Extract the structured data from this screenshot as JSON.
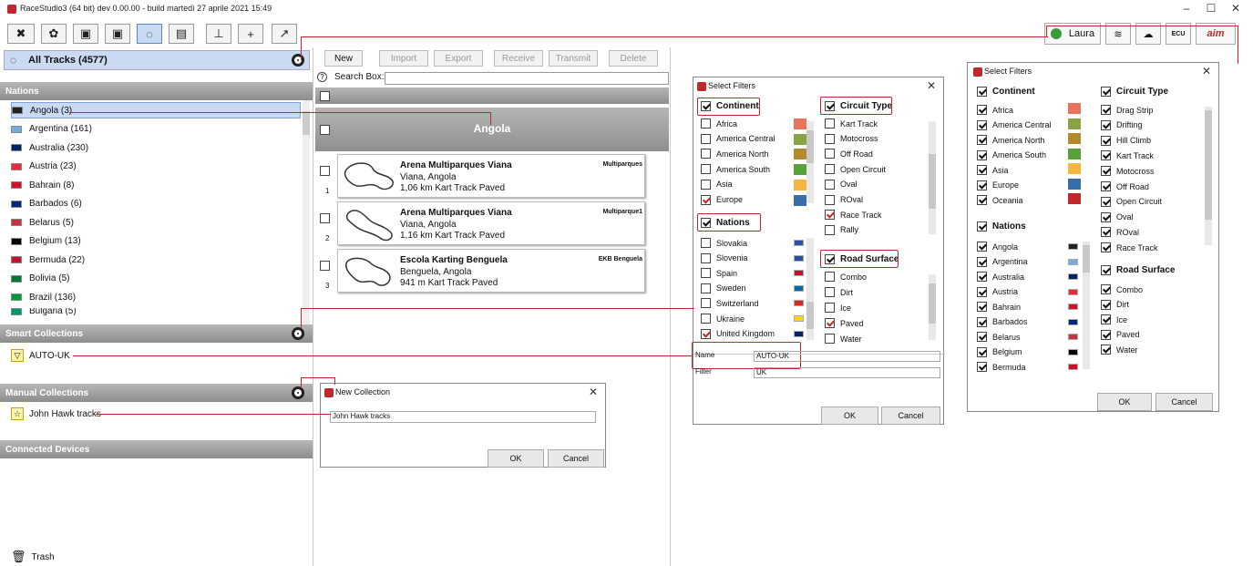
{
  "window": {
    "title": "RaceStudio3 (64 bit) dev 0.00.00 - build martedì 27 aprile 2021 15:49",
    "user": "Laura"
  },
  "toolbar": {
    "icons": [
      "tools-icon",
      "settings-icon",
      "device-icon",
      "device2-icon",
      "tracks-icon",
      "logs-icon",
      "chart-icon",
      "add-icon",
      "export-icon"
    ],
    "right_icons": [
      "wifi-icon",
      "cloud-icon",
      "ecu-icon",
      "aim-logo"
    ],
    "ecu_label": "ECU"
  },
  "left": {
    "all_tracks": "All Tracks (4577)",
    "nations_header": "Nations",
    "nations": [
      {
        "label": "Angola (3)",
        "color": "#222"
      },
      {
        "label": "Argentina (161)",
        "color": "#74acdf"
      },
      {
        "label": "Australia (230)",
        "color": "#012169"
      },
      {
        "label": "Austria (23)",
        "color": "#ed2939"
      },
      {
        "label": "Bahrain (8)",
        "color": "#ce1126"
      },
      {
        "label": "Barbados (6)",
        "color": "#00267f"
      },
      {
        "label": "Belarus (5)",
        "color": "#c8313e"
      },
      {
        "label": "Belgium (13)",
        "color": "#000"
      },
      {
        "label": "Bermuda (22)",
        "color": "#c8102e"
      },
      {
        "label": "Bolivia (5)",
        "color": "#007934"
      },
      {
        "label": "Brazil (136)",
        "color": "#009c3b"
      },
      {
        "label": "Bulgaria (5)",
        "color": "#00966e"
      }
    ],
    "smart_header": "Smart Collections",
    "smart_items": [
      "AUTO-UK"
    ],
    "manual_header": "Manual Collections",
    "manual_items": [
      "John Hawk tracks"
    ],
    "devices_header": "Connected Devices",
    "trash": "Trash"
  },
  "middle": {
    "buttons": {
      "new": "New",
      "import": "Import",
      "export": "Export",
      "receive": "Receive",
      "transmit": "Transmit",
      "delete": "Delete"
    },
    "search_label": "Search Box:",
    "group_title": "Angola",
    "tracks": [
      {
        "num": "1",
        "name": "Arena Multiparques Viana",
        "location": "Viana, Angola",
        "length": "1,06 km Kart Track Paved",
        "tag": "Multiparques"
      },
      {
        "num": "2",
        "name": "Arena Multiparques Viana",
        "location": "Viana, Angola",
        "length": "1,16 km Kart Track Paved",
        "tag": "Multiparque1"
      },
      {
        "num": "3",
        "name": "Escola Karting Benguela",
        "location": "Benguela, Angola",
        "length": "941 m Kart Track Paved",
        "tag": "EKB Benguela"
      }
    ]
  },
  "new_collection": {
    "title": "New Collection",
    "value": "John Hawk tracks",
    "ok": "OK",
    "cancel": "Cancel"
  },
  "filters1": {
    "title": "Select Filters",
    "continent_label": "Continent",
    "continents": [
      {
        "label": "Africa",
        "checked": false
      },
      {
        "label": "America Central",
        "checked": false
      },
      {
        "label": "America North",
        "checked": false
      },
      {
        "label": "America South",
        "checked": false
      },
      {
        "label": "Asia",
        "checked": false
      },
      {
        "label": "Europe",
        "checked": true
      }
    ],
    "nations_label": "Nations",
    "nations": [
      {
        "label": "Slovakia",
        "checked": false
      },
      {
        "label": "Slovenia",
        "checked": false
      },
      {
        "label": "Spain",
        "checked": false
      },
      {
        "label": "Sweden",
        "checked": false
      },
      {
        "label": "Switzerland",
        "checked": false
      },
      {
        "label": "Ukraine",
        "checked": false
      },
      {
        "label": "United Kingdom",
        "checked": true
      }
    ],
    "circuit_label": "Circuit Type",
    "circuits": [
      {
        "label": "Kart Track",
        "checked": false
      },
      {
        "label": "Motocross",
        "checked": false
      },
      {
        "label": "Off Road",
        "checked": false
      },
      {
        "label": "Open Circuit",
        "checked": false
      },
      {
        "label": "Oval",
        "checked": false
      },
      {
        "label": "ROval",
        "checked": false
      },
      {
        "label": "Race Track",
        "checked": true
      },
      {
        "label": "Rally",
        "checked": false
      }
    ],
    "surface_label": "Road Surface",
    "surfaces": [
      {
        "label": "Combo",
        "checked": false
      },
      {
        "label": "Dirt",
        "checked": false
      },
      {
        "label": "Ice",
        "checked": false
      },
      {
        "label": "Paved",
        "checked": true
      },
      {
        "label": "Water",
        "checked": false
      }
    ],
    "name_label": "Name",
    "name_value": "AUTO-UK",
    "filter_label": "Filter",
    "filter_value": "UK",
    "ok": "OK",
    "cancel": "Cancel"
  },
  "filters2": {
    "title": "Select Filters",
    "continent_label": "Continent",
    "continents": [
      "Africa",
      "America Central",
      "America North",
      "America South",
      "Asia",
      "Europe",
      "Oceania"
    ],
    "nations_label": "Nations",
    "nations": [
      "Angola",
      "Argentina",
      "Australia",
      "Austria",
      "Bahrain",
      "Barbados",
      "Belarus",
      "Belgium",
      "Bermuda"
    ],
    "circuit_label": "Circuit Type",
    "circuits": [
      "Drag Strip",
      "Drifting",
      "Hill Climb",
      "Kart Track",
      "Motocross",
      "Off Road",
      "Open Circuit",
      "Oval",
      "ROval",
      "Race Track"
    ],
    "surface_label": "Road Surface",
    "surfaces": [
      "Combo",
      "Dirt",
      "Ice",
      "Paved",
      "Water"
    ],
    "ok": "OK",
    "cancel": "Cancel"
  }
}
